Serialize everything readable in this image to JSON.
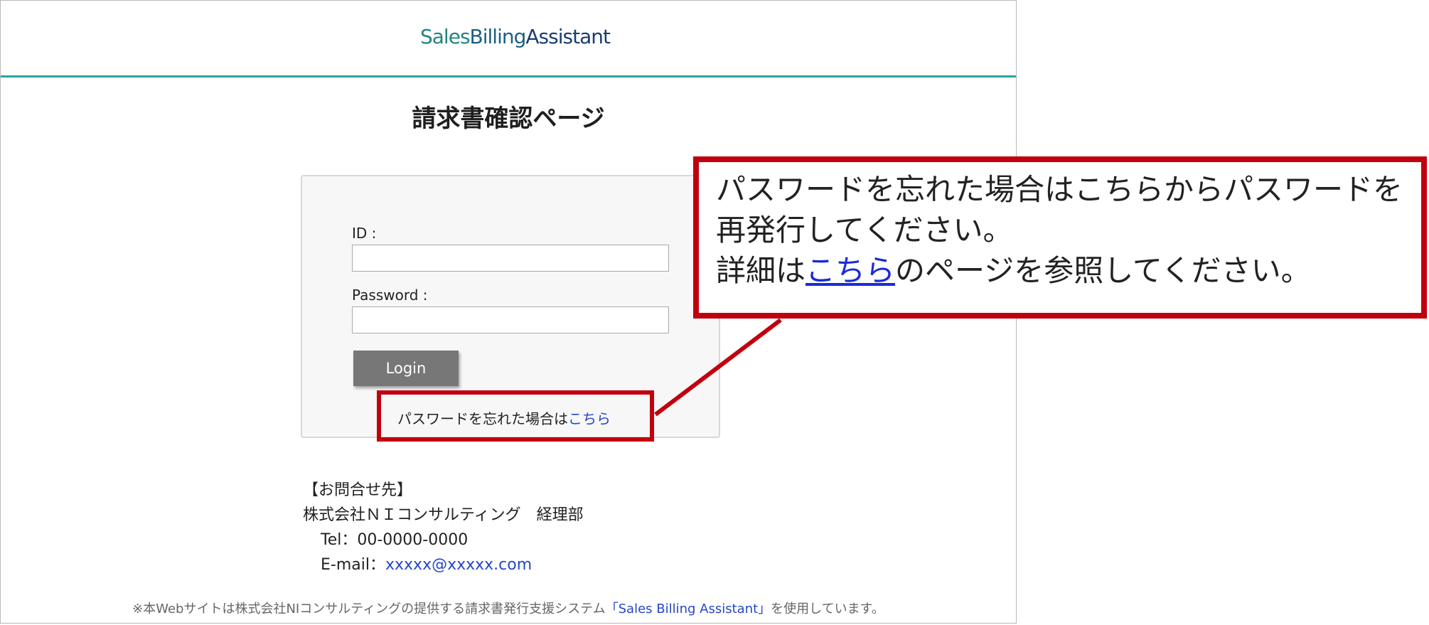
{
  "header": {
    "logo_part1": "Sales",
    "logo_part2": "Billing",
    "logo_part3": "Assistant",
    "accent_color": "#2aa3a0"
  },
  "page": {
    "title": "請求書確認ページ"
  },
  "login_form": {
    "id_label": "ID :",
    "id_value": "",
    "password_label": "Password :",
    "password_value": "",
    "login_button": "Login",
    "forgot_prefix": "パスワードを忘れた場合は",
    "forgot_link": "こちら"
  },
  "callout": {
    "line1": "パスワードを忘れた場合はこちらからパスワードを",
    "line2": "再発行してください。",
    "line3_prefix": "詳細は",
    "line3_link": "こちら",
    "line3_suffix": "のページを参照してください。",
    "border_color": "#c1000e"
  },
  "contact": {
    "heading": "【お問合せ先】",
    "company": "株式会社ＮＩコンサルティング　経理部",
    "tel": "Tel：00-0000-0000",
    "email_label": "E-mail：",
    "email_link": "xxxxx@xxxxx.com"
  },
  "footer": {
    "prefix": "※本Webサイトは株式会社NIコンサルティングの提供する請求書発行支援システム",
    "link": "「Sales Billing Assistant」",
    "suffix": "を使用しています。"
  }
}
